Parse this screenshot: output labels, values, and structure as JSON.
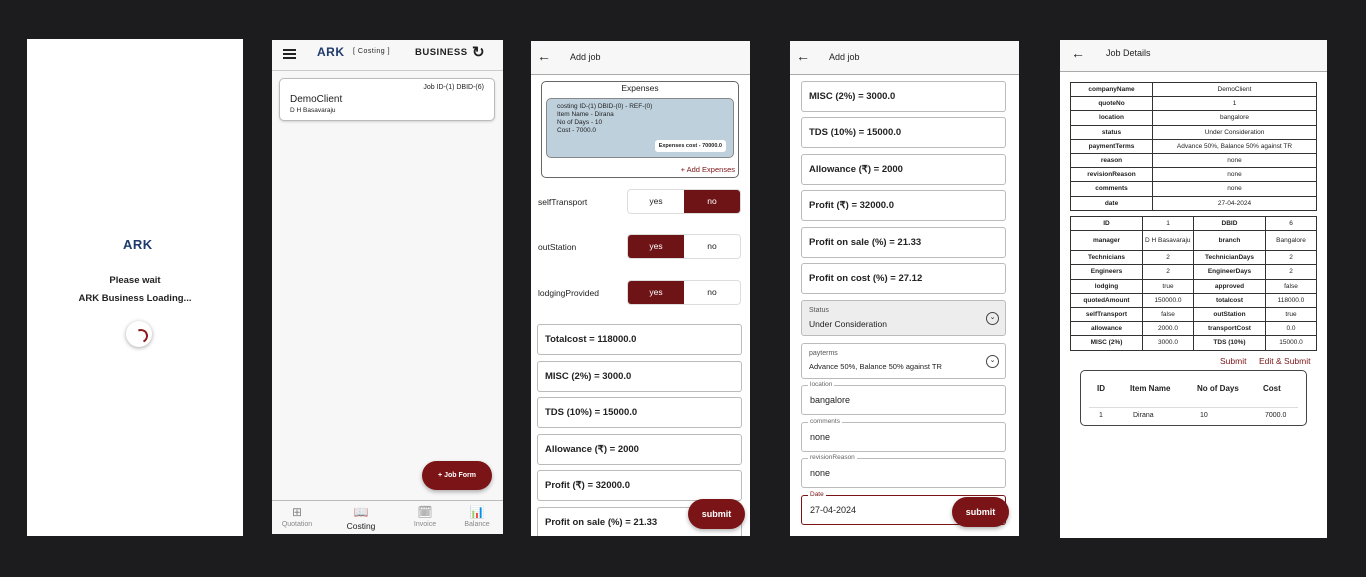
{
  "screen1": {
    "logo": "ARK",
    "wait": "Please wait",
    "loading": "ARK Business Loading..."
  },
  "screen2": {
    "logo": "ARK",
    "logo_sub": "[ Costing ]",
    "business": "BUSINESS",
    "card": {
      "job_ids": "Job ID-(1)  DBID-(6)",
      "client": "DemoClient",
      "manager": "D H Basavaraju"
    },
    "fab": "+  Job Form",
    "nav": [
      {
        "icon": "⊞",
        "label": "Quotation"
      },
      {
        "icon": "📖",
        "label": "Costing"
      },
      {
        "icon": "🗓",
        "label": "Invoice"
      },
      {
        "icon": "📊",
        "label": "Balance"
      }
    ]
  },
  "screen3": {
    "title": "Add job",
    "expenses_header": "Expenses",
    "exp_lines": [
      "costing ID-(1)  DBID-(0)  - REF-(0)",
      "Item Name - Dirana",
      "No of Days - 10",
      "Cost - 7000.0"
    ],
    "exp_badge": "Expenses cost - 70000.0",
    "add_expenses": "+ Add Expenses",
    "toggles": [
      {
        "label": "selfTransport",
        "yes": "yes",
        "no": "no",
        "selected": "no"
      },
      {
        "label": "outStation",
        "yes": "yes",
        "no": "no",
        "selected": "yes"
      },
      {
        "label": "lodgingProvided",
        "yes": "yes",
        "no": "no",
        "selected": "yes"
      }
    ],
    "fields": [
      "Totalcost = 118000.0",
      "MISC (2%) = 3000.0",
      "TDS (10%) = 15000.0",
      "Allowance (₹) = 2000",
      "Profit (₹) = 32000.0",
      "Profit on sale (%) = 21.33"
    ],
    "submit": "submit"
  },
  "screen4": {
    "title": "Add job",
    "fields": [
      "MISC (2%) = 3000.0",
      "TDS (10%) = 15000.0",
      "Allowance (₹) = 2000",
      "Profit (₹) = 32000.0",
      "Profit on sale (%) = 21.33",
      "Profit on cost (%) = 27.12"
    ],
    "status": {
      "label": "Status",
      "value": "Under Consideration"
    },
    "payterms": {
      "label": "payterms",
      "value": "Advance 50%, Balance 50% against TR"
    },
    "location": {
      "label": "location",
      "value": "bangalore"
    },
    "comments": {
      "label": "comments",
      "value": "none"
    },
    "revision": {
      "label": "revisionReason",
      "value": "none"
    },
    "date": {
      "label": "Date",
      "value": "27-04-2024"
    },
    "submit": "submit"
  },
  "screen5": {
    "title": "Job Details",
    "table1": [
      [
        "companyName",
        "DemoClient"
      ],
      [
        "quoteNo",
        "1"
      ],
      [
        "location",
        "bangalore"
      ],
      [
        "status",
        "Under Consideration"
      ],
      [
        "paymentTerms",
        "Advance 50%, Balance 50% against TR"
      ],
      [
        "reason",
        "none"
      ],
      [
        "revisionReason",
        "none"
      ],
      [
        "comments",
        "none"
      ],
      [
        "date",
        "27-04-2024"
      ]
    ],
    "table2": [
      [
        "ID",
        "1",
        "DBID",
        "6"
      ],
      [
        "manager",
        "D H Basavaraju",
        "branch",
        "Bangalore"
      ],
      [
        "Technicians",
        "2",
        "TechnicianDays",
        "2"
      ],
      [
        "Engineers",
        "2",
        "EngineerDays",
        "2"
      ],
      [
        "lodging",
        "true",
        "approved",
        "false"
      ],
      [
        "quotedAmount",
        "150000.0",
        "totalcost",
        "118000.0"
      ],
      [
        "selfTransport",
        "false",
        "outStation",
        "true"
      ],
      [
        "allowance",
        "2000.0",
        "transportCost",
        "0.0"
      ],
      [
        "MISC (2%)",
        "3000.0",
        "TDS (10%)",
        "15000.0"
      ]
    ],
    "submit": "Submit",
    "edit_submit": "Edit & Submit",
    "items_header": [
      "ID",
      "Item Name",
      "No of Days",
      "Cost"
    ],
    "items_row": [
      "1",
      "Dirana",
      "10",
      "7000.0"
    ]
  }
}
